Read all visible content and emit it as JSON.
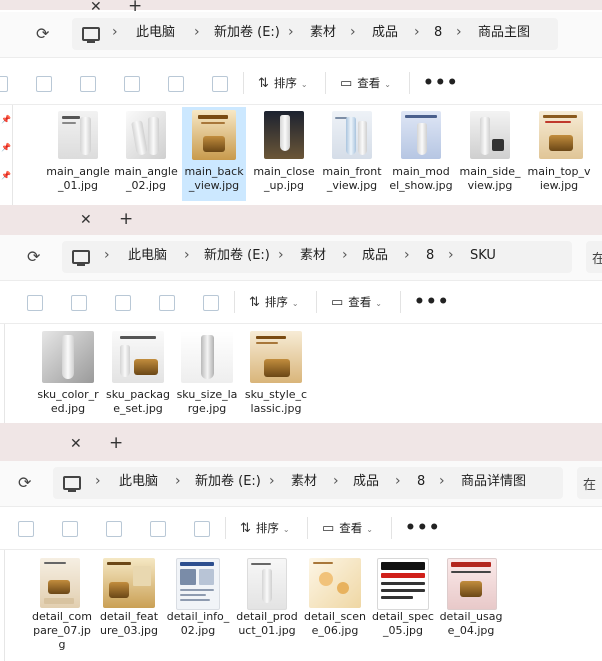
{
  "windows": [
    {
      "path": [
        "此电脑",
        "新加卷 (E:)",
        "素材",
        "成品",
        "8",
        "商品主图"
      ],
      "search": "",
      "files": [
        "main_angle_01.jpg",
        "main_angle_02.jpg",
        "main_back_view.jpg",
        "main_close_up.jpg",
        "main_front_view.jpg",
        "main_model_show.jpg",
        "main_side_view.jpg",
        "main_top_view.jpg"
      ]
    },
    {
      "path": [
        "此电脑",
        "新加卷 (E:)",
        "素材",
        "成品",
        "8",
        "SKU"
      ],
      "search": "在",
      "files": [
        "sku_color_red.jpg",
        "sku_package_set.jpg",
        "sku_size_large.jpg",
        "sku_style_classic.jpg"
      ]
    },
    {
      "path": [
        "此电脑",
        "新加卷 (E:)",
        "素材",
        "成品",
        "8",
        "商品详情图"
      ],
      "search": "在",
      "files": [
        "detail_compare_07.jpg",
        "detail_feature_03.jpg",
        "detail_info_02.jpg",
        "detail_product_01.jpg",
        "detail_scene_06.jpg",
        "detail_spec_05.jpg",
        "detail_usage_04.jpg"
      ]
    }
  ],
  "toolbar": {
    "sort": "排序",
    "view": "查看",
    "more": "•••"
  },
  "icons": {
    "tab_close": "close-icon",
    "tab_add": "add-tab-icon",
    "refresh": "refresh-icon",
    "this_pc": "monitor-icon",
    "pin": "pin-icon"
  },
  "colors": {
    "tab_bar": "#f0e6e6",
    "address_bar": "#fafafa",
    "selection": "#cce8ff"
  }
}
